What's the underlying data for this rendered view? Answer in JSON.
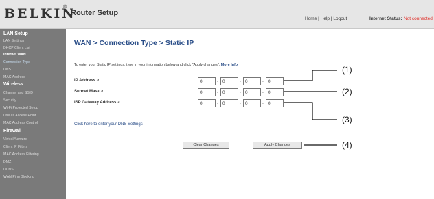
{
  "header": {
    "logo": "BELKIN",
    "logo_mark": "®",
    "app_title": "Router Setup",
    "links": {
      "home": "Home",
      "sep1": "|",
      "help": "Help",
      "sep2": "|",
      "logout": "Logout"
    },
    "status_label": "Internet Status:",
    "status_value": "Not connected"
  },
  "sidebar": {
    "lan_setup": "LAN Setup",
    "lan_settings": "LAN Settings",
    "dhcp_client_list": "DHCP Client List",
    "internet_wan": "Internet WAN",
    "connection_type": "Connection Type",
    "dns": "DNS",
    "mac_address": "MAC Address",
    "wireless": "Wireless",
    "channel_ssid": "Channel and SSID",
    "security": "Security",
    "wifi_protected_setup": "Wi-Fi Protected Setup",
    "use_as_access_point": "Use as Access Point",
    "mac_address_control": "MAC Address Control",
    "firewall": "Firewall",
    "virtual_servers": "Virtual Servers",
    "client_ip_filters": "Client IP Filters",
    "mac_address_filtering": "MAC Address Filtering",
    "dmz": "DMZ",
    "ddns": "DDNS",
    "wan_ping_blocking": "WAN Ping Blocking"
  },
  "main": {
    "title": "WAN > Connection Type > Static IP",
    "instructions": "To enter your Static IP settings, type in your information below and click \"Apply changes\".",
    "more_info": "More Info",
    "fields": [
      {
        "label": "IP Address >",
        "octets": [
          "0",
          "0",
          "0",
          "0"
        ]
      },
      {
        "label": "Subnet Mask >",
        "octets": [
          "0",
          "0",
          "0",
          "0"
        ]
      },
      {
        "label": "ISP Gateway Address >",
        "octets": [
          "0",
          "0",
          "0",
          "0"
        ]
      }
    ],
    "dot": ".",
    "dns_link": "Click here to enter your DNS Settings",
    "clear_button": "Clear Changes",
    "apply_button": "Apply Changes"
  },
  "callouts": [
    "(1)",
    "(2)",
    "(3)",
    "(4)"
  ],
  "colors": {
    "title_blue": "#284c87",
    "sidebar_bg": "#7a7a7a",
    "status_red": "#e0302a",
    "header_bg": "#e6e6e6"
  }
}
